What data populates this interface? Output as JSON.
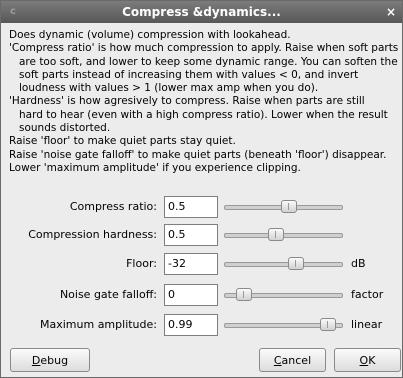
{
  "window": {
    "title": "Compress &dynamics...",
    "close_icon": "close-icon",
    "close_glyph": "×",
    "menu_glyph": "c"
  },
  "description": [
    {
      "text": "Does dynamic (volume) compression with lookahead.",
      "indent": false
    },
    {
      "text": "'Compress ratio' is how much compression to apply. Raise when soft parts",
      "indent": false
    },
    {
      "text": "are too soft, and lower to keep some dynamic range. You can soften the",
      "indent": true
    },
    {
      "text": "soft parts instead of increasing them with values < 0, and invert",
      "indent": true
    },
    {
      "text": "loudness with values > 1 (lower max amp when you do).",
      "indent": true
    },
    {
      "text": "'Hardness' is how agresively to compress. Raise when parts are still",
      "indent": false
    },
    {
      "text": "hard to hear (even with a high compress ratio). Lower when the result",
      "indent": true
    },
    {
      "text": "sounds distorted.",
      "indent": true
    },
    {
      "text": "Raise 'floor' to make quiet parts stay quiet.",
      "indent": false
    },
    {
      "text": "Raise 'noise gate falloff' to make quiet parts (beneath 'floor') disappear.",
      "indent": false
    },
    {
      "text": "Lower 'maximum amplitude' if you experience clipping.",
      "indent": false
    }
  ],
  "controls": [
    {
      "label": "Compress ratio:",
      "value": "0.5",
      "unit": "",
      "slider_fraction": 0.56
    },
    {
      "label": "Compression hardness:",
      "value": "0.5",
      "unit": "",
      "slider_fraction": 0.44
    },
    {
      "label": "Floor:",
      "value": "-32",
      "unit": "dB",
      "slider_fraction": 0.63
    },
    {
      "label": "Noise gate falloff:",
      "value": "0",
      "unit": "factor",
      "slider_fraction": 0.12
    },
    {
      "label": "Maximum amplitude:",
      "value": "0.99",
      "unit": "linear",
      "slider_fraction": 0.95
    }
  ],
  "buttons": {
    "debug": {
      "mnemonic": "D",
      "rest": "ebug"
    },
    "cancel": {
      "mnemonic": "C",
      "rest": "ancel"
    },
    "ok": {
      "mnemonic": "O",
      "rest": "K"
    }
  }
}
